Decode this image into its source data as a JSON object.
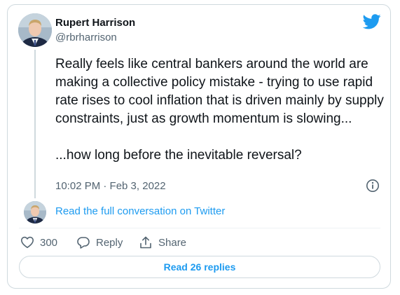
{
  "author": {
    "name": "Rupert Harrison",
    "handle": "@rbrharrison"
  },
  "tweet": {
    "text": "Really feels like central bankers around the world are making a collective policy mistake - trying to use rapid rate rises to cool inflation that is driven mainly by supply constraints, just as growth momentum is slowing...\n\n...how long before the inevitable reversal?",
    "timestamp": "10:02 PM · Feb 3, 2022"
  },
  "conversation_link": "Read the full conversation on Twitter",
  "actions": {
    "likes": "300",
    "reply_label": "Reply",
    "share_label": "Share"
  },
  "replies_button": "Read 26 replies",
  "colors": {
    "brand": "#1d9bf0",
    "text": "#0f1419",
    "muted": "#536471",
    "border": "#cfd9de"
  },
  "icons": [
    "twitter-bird-icon",
    "info-icon",
    "heart-icon",
    "reply-icon",
    "share-icon"
  ]
}
